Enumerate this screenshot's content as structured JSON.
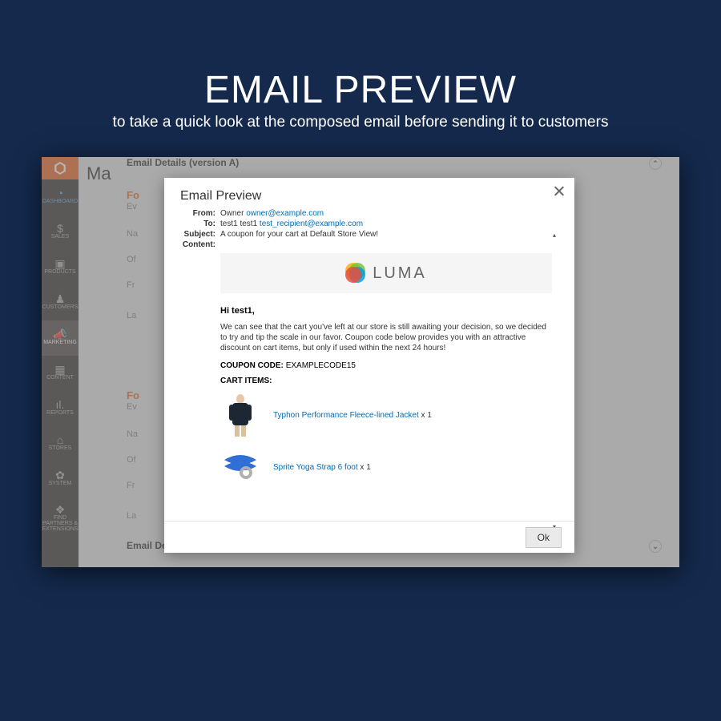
{
  "hero": {
    "title": "EMAIL PREVIEW",
    "subtitle": "to take a quick look at the composed email before sending it to customers"
  },
  "app": {
    "partial_title": "Ma",
    "section_a": "Email Details (version A)",
    "section_b_partial": "Email Details (vers"
  },
  "sidebar": {
    "items": [
      {
        "icon": "◆",
        "label": ""
      },
      {
        "icon": "⌂",
        "label": "DASHBOARD"
      },
      {
        "icon": "$",
        "label": "SALES"
      },
      {
        "icon": "▣",
        "label": "PRODUCTS"
      },
      {
        "icon": "♟",
        "label": "CUSTOMERS"
      },
      {
        "icon": "◀",
        "label": "MARKETING"
      },
      {
        "icon": "▦",
        "label": "CONTENT"
      },
      {
        "icon": "ıl.",
        "label": "REPORTS"
      },
      {
        "icon": "⌂",
        "label": "STORES"
      },
      {
        "icon": "✿",
        "label": "SYSTEM"
      },
      {
        "icon": "❖",
        "label": "FIND PARTNERS & EXTENSIONS"
      }
    ]
  },
  "background_rows": {
    "heads": [
      "Fo",
      "Fo"
    ],
    "sub": "Ev",
    "rows": [
      "Na",
      "Of",
      "Fr",
      "La"
    ]
  },
  "modal": {
    "title": "Email Preview",
    "from_label": "From:",
    "from_name": "Owner",
    "from_email": "owner@example.com",
    "to_label": "To:",
    "to_name": "test1 test1",
    "to_email": "test_recipient@example.com",
    "subject_label": "Subject:",
    "subject_value": "A coupon for your cart at Default Store View!",
    "content_label": "Content:",
    "ok": "Ok"
  },
  "email": {
    "brand": "LUMA",
    "greeting": "Hi test1,",
    "paragraph": "We can see that the cart you've left at our store is still awaiting your decision, so we decided to try and tip the scale in our favor. Coupon code below provides you with an attractive discount on cart items, but only if used within the next 24 hours!",
    "coupon_label": "COUPON CODE:",
    "coupon_code": "EXAMPLECODE15",
    "cart_label": "CART ITEMS:",
    "items": [
      {
        "name": "Typhon Performance Fleece-lined Jacket",
        "qty": "x 1"
      },
      {
        "name": "Sprite Yoga Strap 6 foot",
        "qty": "x 1"
      }
    ]
  }
}
